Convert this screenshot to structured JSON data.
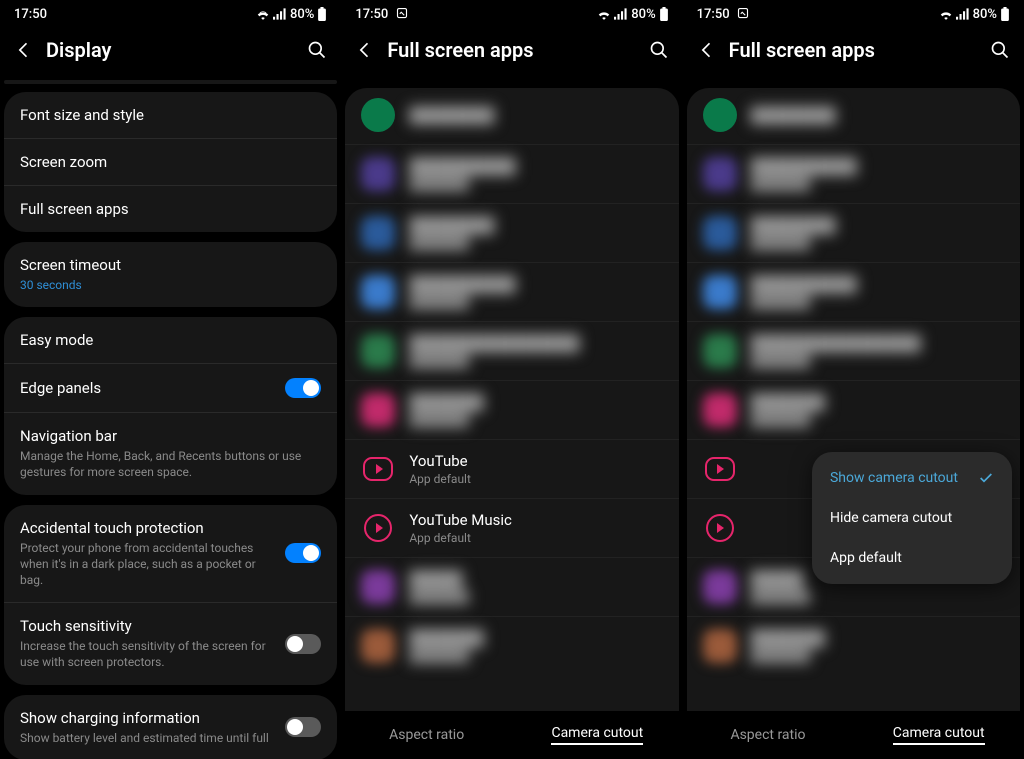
{
  "status": {
    "time": "17:50",
    "battery": "80%"
  },
  "screen1": {
    "title": "Display",
    "groups": [
      {
        "rows": [
          {
            "title": "Font size and style"
          },
          {
            "title": "Screen zoom"
          },
          {
            "title": "Full screen apps"
          }
        ]
      },
      {
        "rows": [
          {
            "title": "Screen timeout",
            "sub": "30 seconds",
            "sub_blue": true
          }
        ]
      },
      {
        "rows": [
          {
            "title": "Easy mode"
          },
          {
            "title": "Edge panels",
            "toggle": true,
            "on": true
          },
          {
            "title": "Navigation bar",
            "sub": "Manage the Home, Back, and Recents buttons or use gestures for more screen space."
          }
        ]
      },
      {
        "rows": [
          {
            "title": "Accidental touch protection",
            "sub": "Protect your phone from accidental touches when it's in a dark place, such as a pocket or bag.",
            "toggle": true,
            "on": true
          },
          {
            "title": "Touch sensitivity",
            "sub": "Increase the touch sensitivity of the screen for use with screen protectors.",
            "toggle": true,
            "on": false
          }
        ]
      },
      {
        "rows": [
          {
            "title": "Show charging information",
            "sub": "Show battery level and estimated time until full",
            "toggle": true,
            "on": false
          }
        ]
      }
    ]
  },
  "screen2": {
    "title": "Full screen apps",
    "tabs": {
      "aspect": "Aspect ratio",
      "camera": "Camera cutout"
    },
    "yt": {
      "name": "YouTube",
      "sub": "App default"
    },
    "ytm": {
      "name": "YouTube Music",
      "sub": "App default"
    }
  },
  "screen3": {
    "title": "Full screen apps",
    "tabs": {
      "aspect": "Aspect ratio",
      "camera": "Camera cutout"
    },
    "popup": {
      "show": "Show camera cutout",
      "hide": "Hide camera cutout",
      "default": "App default"
    }
  }
}
